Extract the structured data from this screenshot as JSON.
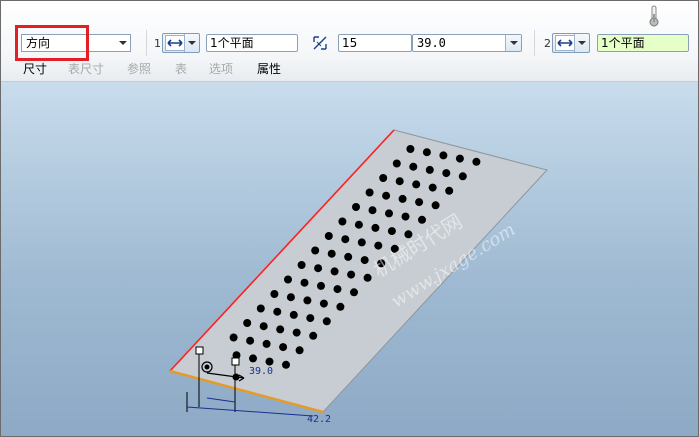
{
  "dashboard": {
    "orientation_combo": "方向",
    "reference1": {
      "index": "1",
      "value": "1个平面"
    },
    "reference2": {
      "index": "2",
      "value": "1个平面"
    },
    "spacing_value": "15",
    "dimension_value": "39.0",
    "tabs": [
      {
        "label": "尺寸",
        "enabled": true
      },
      {
        "label": "表尺寸",
        "enabled": false
      },
      {
        "label": "参照",
        "enabled": false
      },
      {
        "label": "表",
        "enabled": false
      },
      {
        "label": "选项",
        "enabled": false
      },
      {
        "label": "属性",
        "enabled": true
      }
    ]
  },
  "viewport": {
    "dim_label_1": "39.0",
    "dim_label_2": "42.2",
    "watermark_line1": "机械时代网",
    "watermark_line2": "www.jxage.com"
  },
  "colors": {
    "highlight": "#e31e24",
    "plate": "#c7cdd2",
    "edge_red": "#ff2020",
    "edge_orange": "#e59b2a",
    "reference2_field": "#e6ffc9"
  }
}
